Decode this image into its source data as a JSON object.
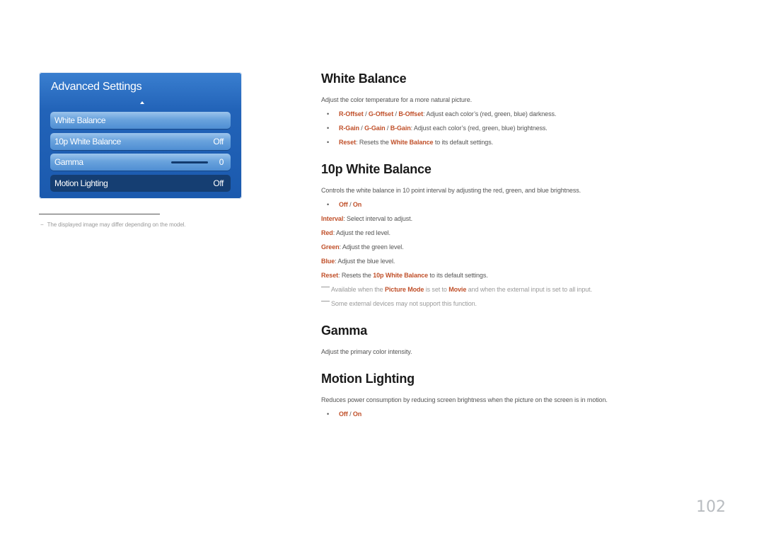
{
  "osd": {
    "title": "Advanced Settings",
    "items": [
      {
        "label": "White Balance",
        "value": ""
      },
      {
        "label": "10p White Balance",
        "value": "Off"
      },
      {
        "label": "Gamma",
        "value": "0",
        "slider_fraction": 0.5
      },
      {
        "label": "Motion Lighting",
        "value": "Off",
        "selected": true
      }
    ]
  },
  "footnote": {
    "dash": "−",
    "text": "The displayed image may differ depending on the model."
  },
  "sections": {
    "white_balance": {
      "title": "White Balance",
      "desc": "Adjust the color temperature for a more natural picture.",
      "bullets": {
        "offset": {
          "r": "R-Offset",
          "sep1": " / ",
          "g": "G-Offset",
          "sep2": " / ",
          "b": "B-Offset",
          "rest": ": Adjust each color’s (red, green, blue) darkness."
        },
        "gain": {
          "r": "R-Gain",
          "sep1": " / ",
          "g": "G-Gain",
          "sep2": " / ",
          "b": "B-Gain",
          "rest": ": Adjust each color’s (red, green, blue) brightness."
        },
        "reset": {
          "label": "Reset",
          "pre": ": Resets the ",
          "ref": "White Balance",
          "post": " to its default settings."
        }
      }
    },
    "tenp_white_balance": {
      "title": "10p White Balance",
      "desc": "Controls the white balance in 10 point interval by adjusting the red, green, and blue brightness.",
      "options": {
        "off": "Off",
        "sep": " / ",
        "on": "On"
      },
      "lines": {
        "interval": {
          "label": "Interval",
          "text": ": Select interval to adjust."
        },
        "red": {
          "label": "Red",
          "text": ": Adjust the red level."
        },
        "green": {
          "label": "Green",
          "text": ": Adjust the green level."
        },
        "blue": {
          "label": "Blue",
          "text": ": Adjust the blue level."
        },
        "reset": {
          "label": "Reset",
          "pre": ": Resets the ",
          "ref": "10p White Balance",
          "post": " to its default settings."
        }
      },
      "notes": {
        "available": {
          "pre": "Available when the ",
          "ref1": "Picture Mode",
          "mid": " is set to ",
          "ref2": "Movie",
          "post": " and when the external input is set to all input."
        },
        "support": "Some external devices may not support this function."
      }
    },
    "gamma": {
      "title": "Gamma",
      "desc": "Adjust the primary color intensity."
    },
    "motion_lighting": {
      "title": "Motion Lighting",
      "desc": "Reduces power consumption by reducing screen brightness when the picture on the screen is in motion.",
      "options": {
        "off": "Off",
        "sep": " / ",
        "on": "On"
      }
    }
  },
  "bullet_char": "•",
  "page_number": "102",
  "colors": {
    "accent": "#c0502a",
    "osd_blue": "#1b5aae",
    "osd_selected": "#153e72"
  }
}
